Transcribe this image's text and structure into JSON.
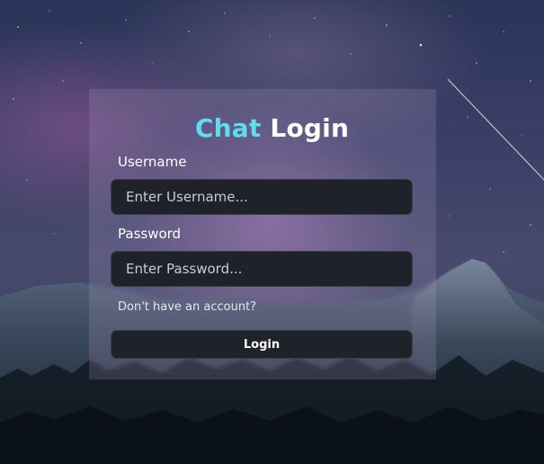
{
  "title": {
    "accent": "Chat",
    "rest": "Login"
  },
  "username": {
    "label": "Username",
    "placeholder": "Enter Username...",
    "value": ""
  },
  "password": {
    "label": "Password",
    "placeholder": "Enter Password...",
    "value": ""
  },
  "signup_link": "Don't have an account?",
  "login_button": "Login",
  "colors": {
    "accent": "#5fdcef",
    "input_bg": "#1f2229",
    "text": "#ffffff"
  },
  "background": {
    "image": "mountain-night-sky"
  }
}
